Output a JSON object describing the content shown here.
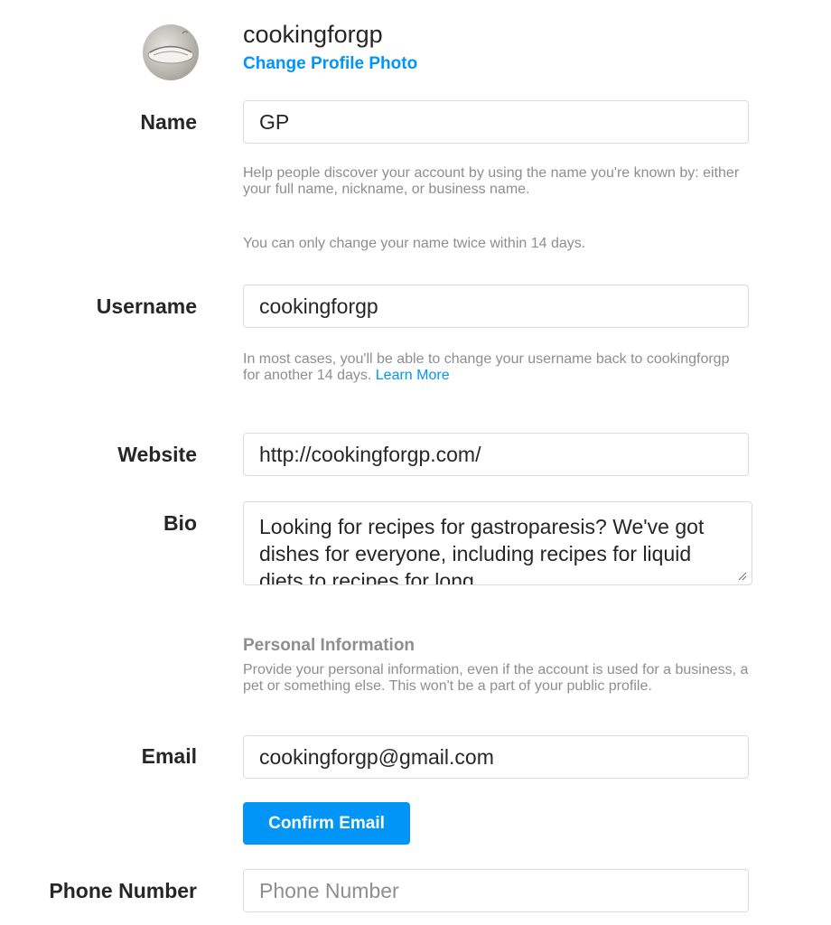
{
  "profile": {
    "username": "cookingforgp",
    "change_photo_label": "Change Profile Photo"
  },
  "fields": {
    "name": {
      "label": "Name",
      "value": "GP",
      "help_1": "Help people discover your account by using the name you're known by: either your full name, nickname, or business name.",
      "help_2": "You can only change your name twice within 14 days."
    },
    "username": {
      "label": "Username",
      "value": "cookingforgp",
      "help": "In most cases, you'll be able to change your username back to cookingforgp for another 14 days.",
      "learn_more": "Learn More"
    },
    "website": {
      "label": "Website",
      "value": "http://cookingforgp.com/"
    },
    "bio": {
      "label": "Bio",
      "value": "Looking for recipes for gastroparesis? We've got dishes for everyone, including recipes for liquid diets to recipes for long"
    },
    "personal_info": {
      "title": "Personal Information",
      "description": "Provide your personal information, even if the account is used for a business, a pet or something else. This won't be a part of your public profile."
    },
    "email": {
      "label": "Email",
      "value": "cookingforgp@gmail.com",
      "confirm_label": "Confirm Email"
    },
    "phone": {
      "label": "Phone Number",
      "value": "",
      "placeholder": "Phone Number"
    }
  },
  "colors": {
    "accent": "#0095f6",
    "text": "#262626",
    "muted": "#8e8e8e",
    "border": "#dbdbdb"
  }
}
